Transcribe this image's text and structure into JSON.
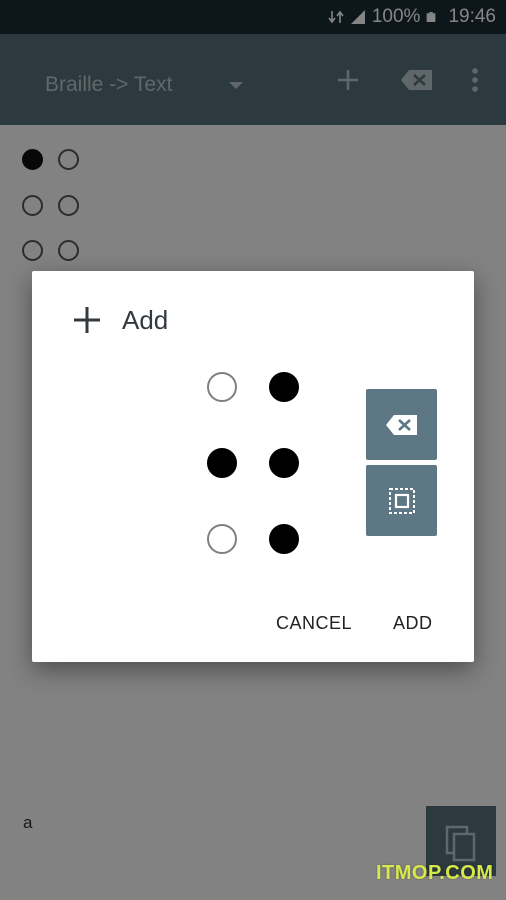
{
  "status_bar": {
    "battery": "100%",
    "time": "19:46",
    "icons": [
      "data-transfer-icon",
      "signal-icon",
      "battery-icon"
    ]
  },
  "app_bar": {
    "mode": "Braille -> Text",
    "actions": [
      "add-icon",
      "backspace-icon",
      "more-vert-icon"
    ]
  },
  "background_cell": {
    "dots": [
      true,
      false,
      false,
      false,
      false,
      false
    ]
  },
  "result": {
    "text": "a"
  },
  "dialog": {
    "title": "Add",
    "dots": [
      false,
      true,
      false,
      true,
      true,
      true
    ],
    "cancel_label": "CANCEL",
    "add_label": "ADD"
  },
  "watermark": "ITMOP.COM",
  "colors": {
    "app_bar": "#556e7a",
    "status_bar": "#192b33",
    "dialog_button": "#5d7784"
  }
}
